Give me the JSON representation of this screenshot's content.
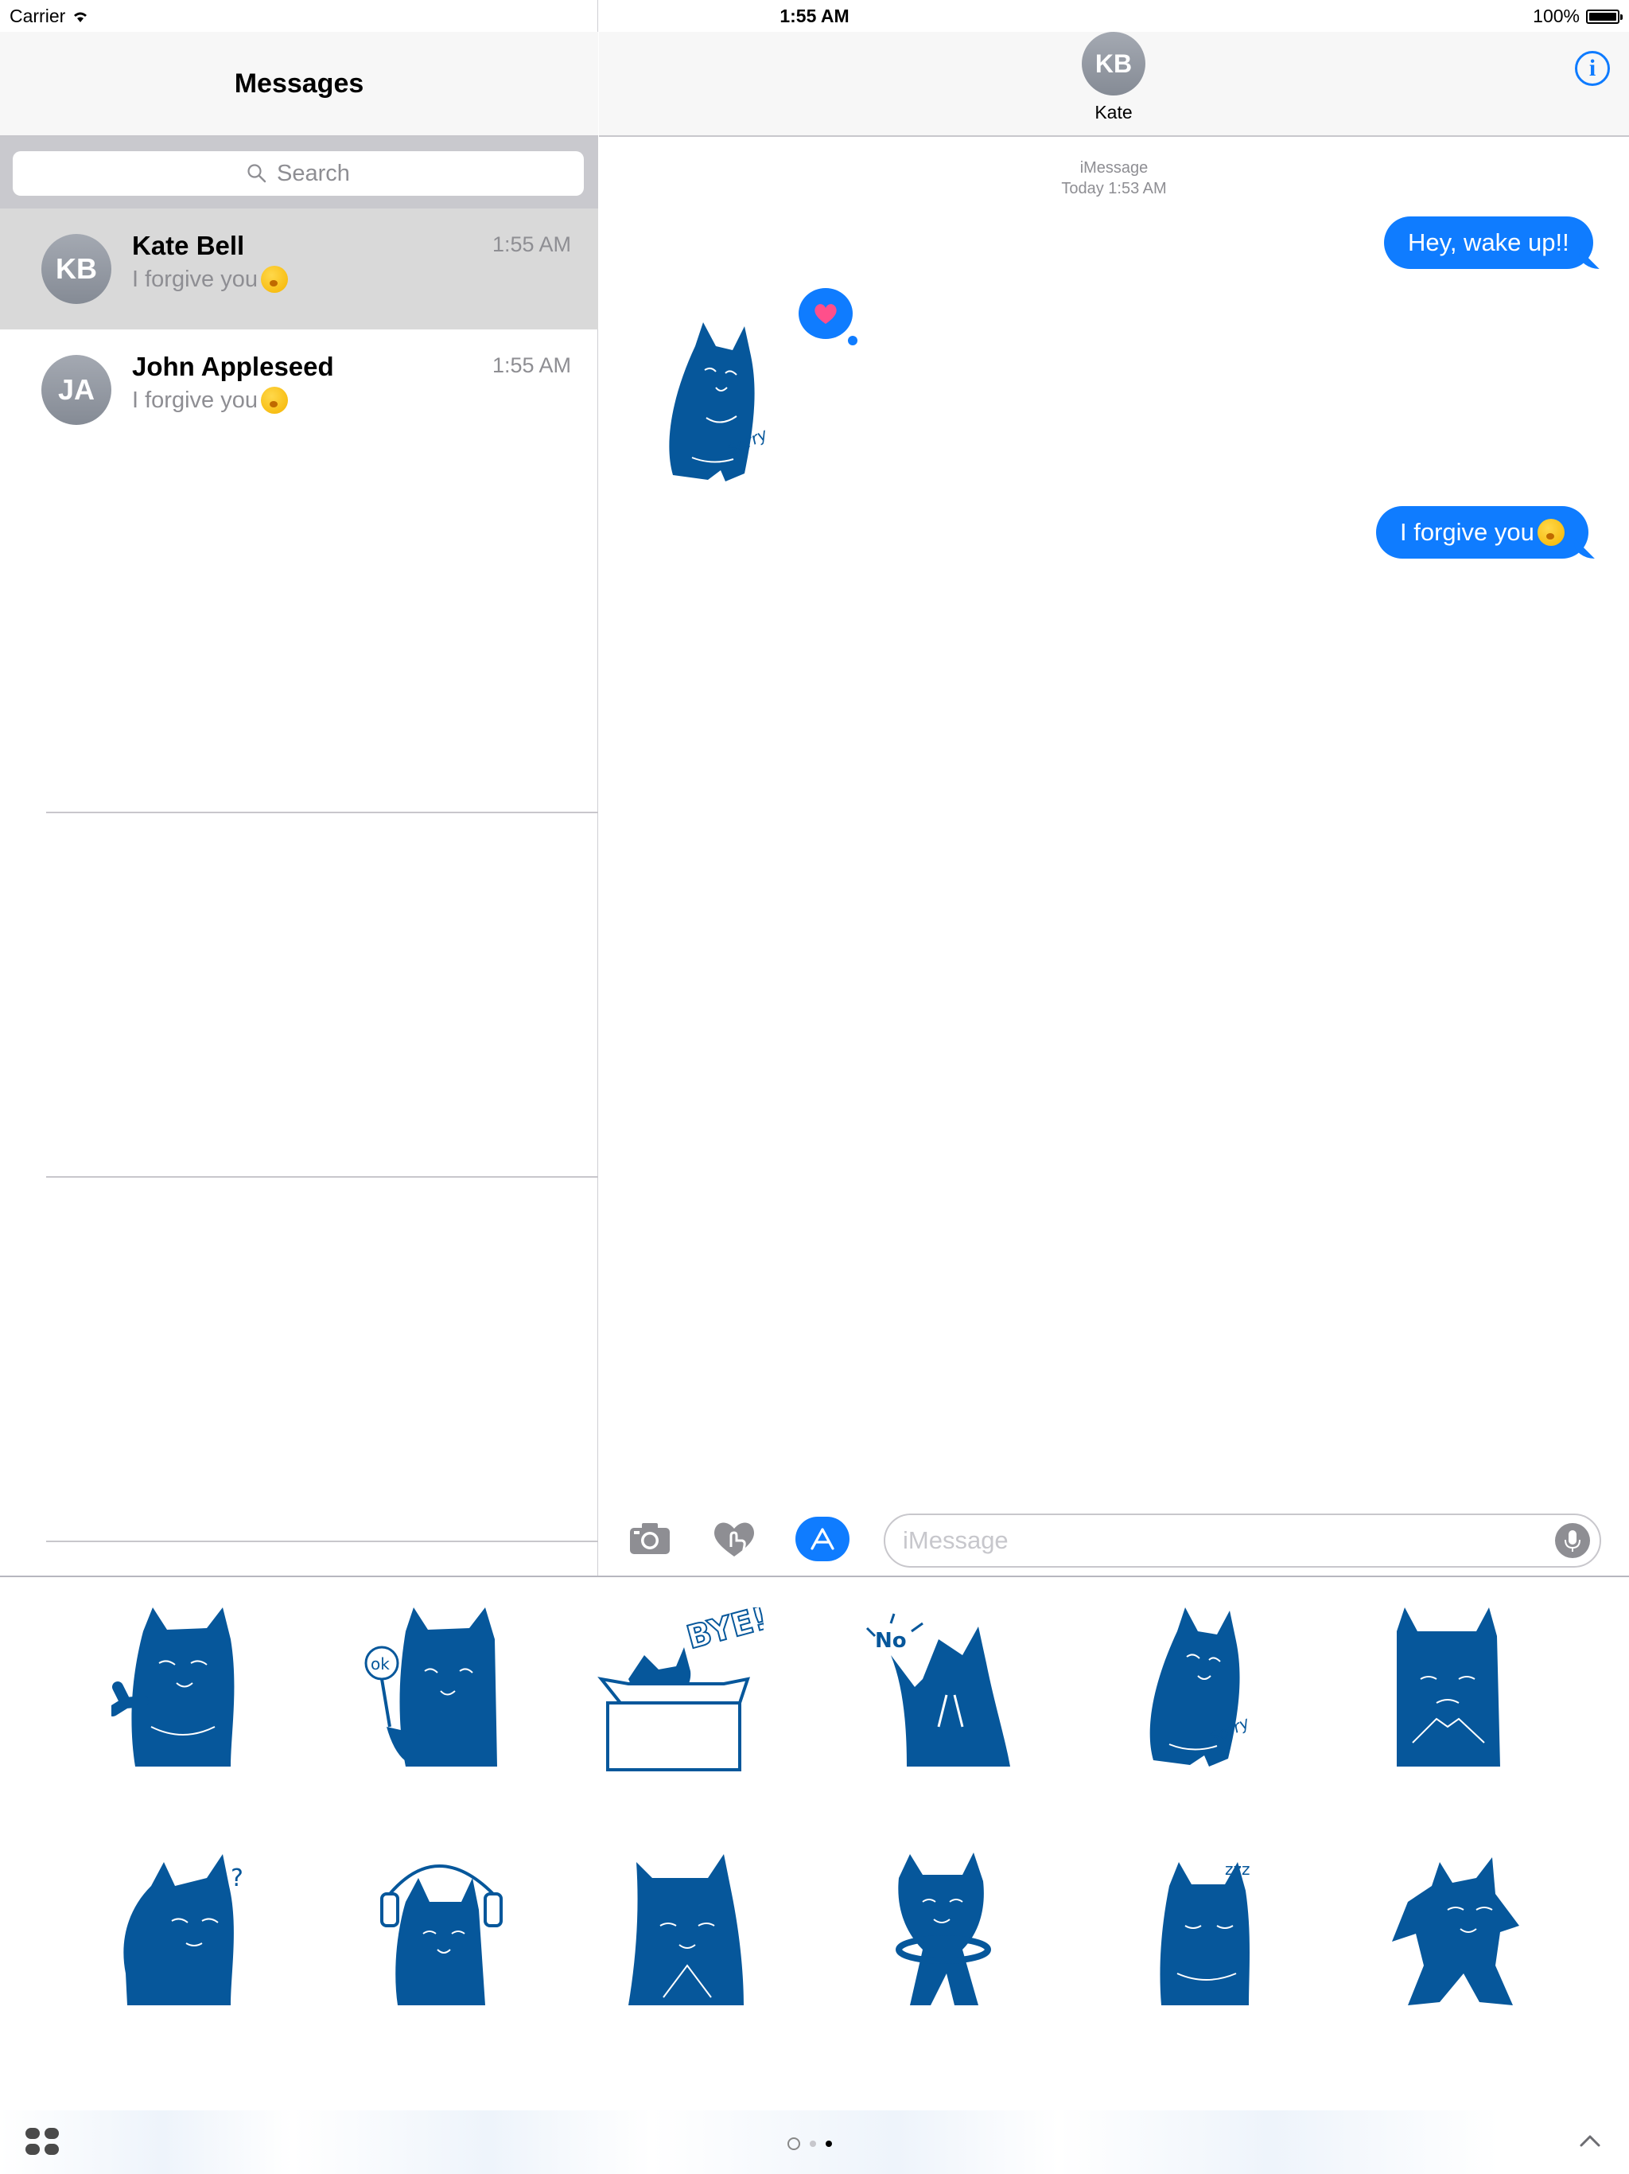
{
  "status_bar": {
    "carrier": "Carrier",
    "time": "1:55 AM",
    "battery": "100%"
  },
  "sidebar": {
    "title": "Messages",
    "search_placeholder": "Search",
    "conversations": [
      {
        "initials": "KB",
        "name": "Kate Bell",
        "time": "1:55 AM",
        "preview": "I forgive you",
        "selected": true
      },
      {
        "initials": "JA",
        "name": "John Appleseed",
        "time": "1:55 AM",
        "preview": "I forgive you",
        "selected": false
      }
    ]
  },
  "conversation": {
    "contact_initials": "KB",
    "contact_name": "Kate",
    "service": "iMessage",
    "timestamp": "Today 1:53 AM",
    "messages": [
      {
        "type": "text",
        "text": "Hey, wake up!!",
        "outgoing": true
      },
      {
        "type": "sticker",
        "name": "sorry-cat"
      },
      {
        "type": "text",
        "text": "I forgive you",
        "outgoing": true
      }
    ],
    "input_placeholder": "iMessage"
  },
  "sticker_drawer": {
    "stickers": [
      "waving-cat",
      "ok-sign-cat",
      "bye-box-cat",
      "no-cat",
      "sorry-cat",
      "sad-cat",
      "question-cat",
      "music-cat",
      "calm-cat",
      "hula-cat",
      "sleepy-cat",
      "dancing-cat"
    ],
    "labels": {
      "bye": "BYE!!",
      "ok": "ok",
      "no": "No",
      "sorry": "Sorry"
    }
  },
  "colors": {
    "accent": "#0f7cff",
    "sticker": "#06579b",
    "selected_row": "#d9d9d9"
  }
}
